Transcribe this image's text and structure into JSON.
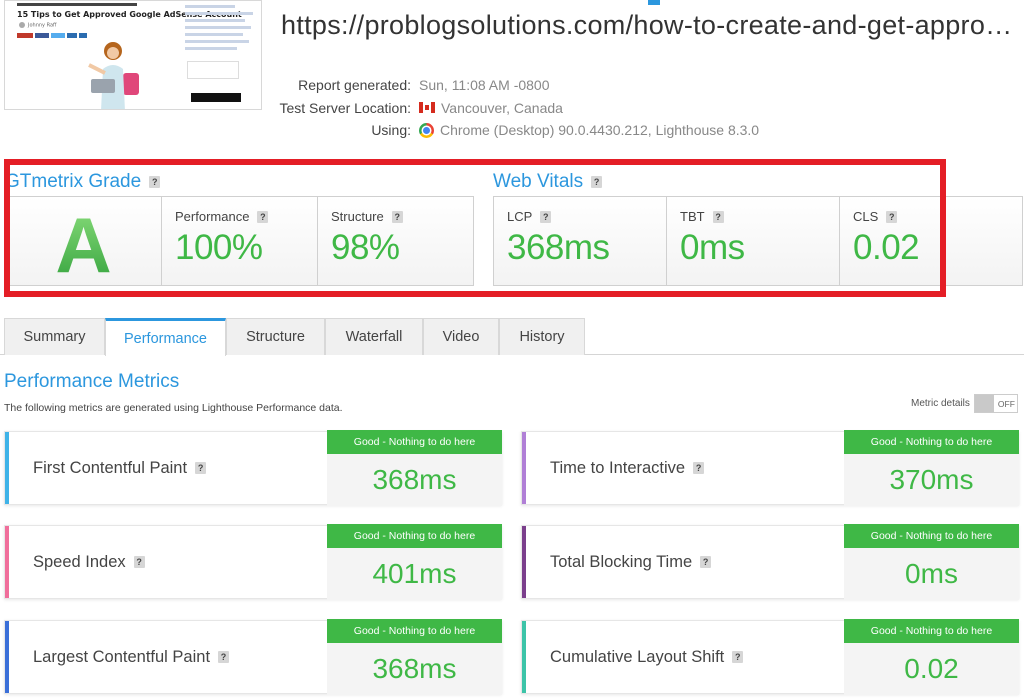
{
  "thumbnail": {
    "title": "15 Tips to Get Approved Google AdSense Account",
    "author": "Johnny Raff"
  },
  "header": {
    "url": "https://problogsolutions.com/how-to-create-and-get-appro…"
  },
  "report": {
    "rows": [
      {
        "label": "Report generated:",
        "value": "Sun,                   11:08 AM -0800",
        "icon": ""
      },
      {
        "label": "Test Server Location:",
        "value": "Vancouver, Canada",
        "icon": "canada-flag-icon"
      },
      {
        "label": "Using:",
        "value": "Chrome (Desktop) 90.0.4430.212, Lighthouse 8.3.0",
        "icon": "chrome-icon"
      }
    ]
  },
  "gtmetrix": {
    "title": "GTmetrix Grade",
    "help": "?",
    "grade": "A",
    "performance_label": "Performance",
    "performance_value": "100%",
    "structure_label": "Structure",
    "structure_value": "98%"
  },
  "web_vitals": {
    "title": "Web Vitals",
    "help": "?",
    "lcp_label": "LCP",
    "lcp_value": "368ms",
    "tbt_label": "TBT",
    "tbt_value": "0ms",
    "cls_label": "CLS",
    "cls_value": "0.02"
  },
  "tabs": [
    "Summary",
    "Performance",
    "Structure",
    "Waterfall",
    "Video",
    "History"
  ],
  "active_tab": "Performance",
  "performance_metrics": {
    "title": "Performance Metrics",
    "subtitle": "The following metrics are generated using Lighthouse Performance data.",
    "metric_details_label": "Metric details",
    "toggle_state": "OFF",
    "badge_text": "Good - Nothing to do here",
    "metrics": [
      {
        "name": "First Contentful Paint",
        "value": "368ms",
        "accent": "#3fb3e8"
      },
      {
        "name": "Time to Interactive",
        "value": "370ms",
        "accent": "#b07fd6"
      },
      {
        "name": "Speed Index",
        "value": "401ms",
        "accent": "#f06e9b"
      },
      {
        "name": "Total Blocking Time",
        "value": "0ms",
        "accent": "#7b3f8c"
      },
      {
        "name": "Largest Contentful Paint",
        "value": "368ms",
        "accent": "#3a6fd8"
      },
      {
        "name": "Cumulative Layout Shift",
        "value": "0.02",
        "accent": "#3cc4a8"
      }
    ]
  },
  "colors": {
    "brand_blue": "#2c97de",
    "good_green": "#3fb846",
    "highlight_red": "#e41e26"
  }
}
